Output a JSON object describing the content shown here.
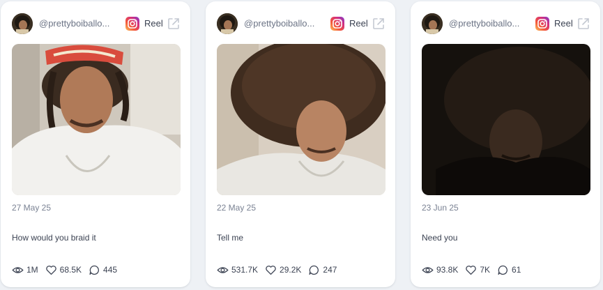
{
  "posts": [
    {
      "handle": "@prettyboiballo...",
      "platform_icon": "instagram-icon",
      "type_label": "Reel",
      "date": "27 May 25",
      "caption": "How would you braid it",
      "views": "1M",
      "likes": "68.5K",
      "comments": "445"
    },
    {
      "handle": "@prettyboiballo...",
      "platform_icon": "instagram-icon",
      "type_label": "Reel",
      "date": "22 May 25",
      "caption": "Tell me",
      "views": "531.7K",
      "likes": "29.2K",
      "comments": "247"
    },
    {
      "handle": "@prettyboiballo...",
      "platform_icon": "instagram-icon",
      "type_label": "Reel",
      "date": "23 Jun 25",
      "caption": "Need you",
      "views": "93.8K",
      "likes": "7K",
      "comments": "61"
    }
  ],
  "colors": {
    "background": "#eef1f5",
    "card": "#ffffff",
    "muted_text": "#7a8293",
    "body_text": "#3b4252",
    "icon_gray": "#c4c9d2"
  }
}
